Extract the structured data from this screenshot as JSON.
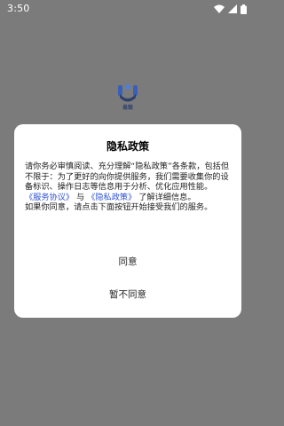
{
  "status_bar": {
    "time": "3:50",
    "icons": [
      "wifi-icon",
      "signal-icon",
      "battery-icon"
    ]
  },
  "app": {
    "logo_text": "易联"
  },
  "dialog": {
    "title": "隐私政策",
    "body_intro": "请你务必审慎阅读、充分理解“隐私政策”各条款，包括但不限于：为了更好的向你提供服务，我们需要收集你的设备标识、操作日志等信息用于分析、优化应用性能。",
    "link_service": "《服务协议》",
    "connector": " 与 ",
    "link_privacy": "《隐私政策》",
    "body_after_links": " 了解详细信息。",
    "body_consent": "如果你同意，请点击下面按钮开始接受我们的服务。",
    "agree_label": "同意",
    "disagree_label": "暂不同意"
  },
  "colors": {
    "backdrop": "#7b7b7b",
    "link": "#2e52d6",
    "dialog_bg": "#ffffff"
  }
}
